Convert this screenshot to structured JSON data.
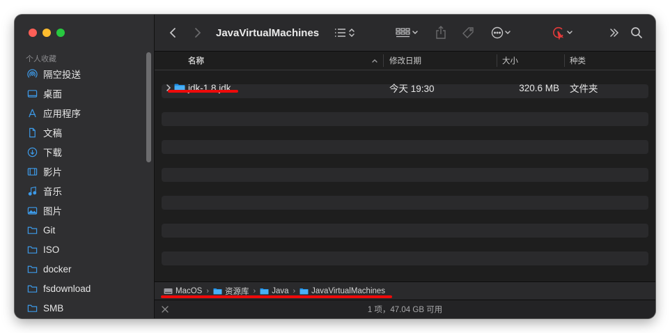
{
  "window": {
    "title": "JavaVirtualMachines"
  },
  "sidebar": {
    "section": "个人收藏",
    "items": [
      {
        "label": "隔空投送",
        "icon": "airdrop-icon"
      },
      {
        "label": "桌面",
        "icon": "desktop-icon"
      },
      {
        "label": "应用程序",
        "icon": "applications-icon"
      },
      {
        "label": "文稿",
        "icon": "document-icon"
      },
      {
        "label": "下载",
        "icon": "download-icon"
      },
      {
        "label": "影片",
        "icon": "film-icon"
      },
      {
        "label": "音乐",
        "icon": "music-icon"
      },
      {
        "label": "图片",
        "icon": "photo-icon"
      },
      {
        "label": "Git",
        "icon": "folder-icon"
      },
      {
        "label": "ISO",
        "icon": "folder-icon"
      },
      {
        "label": "docker",
        "icon": "folder-icon"
      },
      {
        "label": "fsdownload",
        "icon": "folder-icon"
      },
      {
        "label": "SMB",
        "icon": "folder-icon"
      }
    ]
  },
  "columns": {
    "name": "名称",
    "modified": "修改日期",
    "size": "大小",
    "kind": "种类"
  },
  "files": [
    {
      "name": "jdk-1.8.jdk",
      "modified": "今天 19:30",
      "size": "320.6 MB",
      "kind": "文件夹"
    }
  ],
  "pathbar": {
    "crumbs": [
      "MacOS",
      "资源库",
      "Java",
      "JavaVirtualMachines"
    ]
  },
  "status": {
    "text": "1 项，47.04 GB 可用"
  },
  "colors": {
    "accent": "#3d9ae8",
    "annotation": "#ee0a0a",
    "tag_icon": "#e23a3a"
  }
}
